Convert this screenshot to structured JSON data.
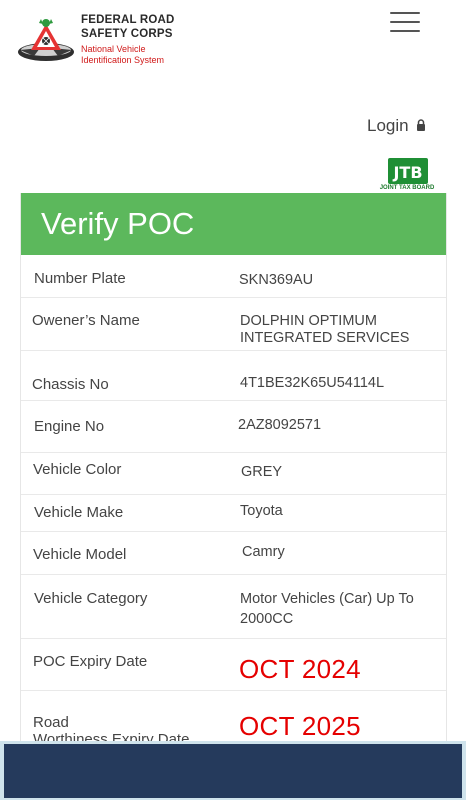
{
  "header": {
    "logo_line1": "FEDERAL ROAD",
    "logo_line2": "SAFETY CORPS",
    "logo_sub1": "National Vehicle",
    "logo_sub2": "Identification System",
    "menu_icon": "hamburger-menu-icon"
  },
  "login": {
    "label": "Login",
    "icon": "lock-icon"
  },
  "jtb": {
    "badge": "JTB",
    "caption": "JOINT TAX BOARD"
  },
  "card": {
    "title": "Verify POC",
    "rows": [
      {
        "label": "Number Plate",
        "value": "SKN369AU"
      },
      {
        "label": "Owener’s Name",
        "value_line1": "DOLPHIN OPTIMUM",
        "value_line2": "INTEGRATED SERVICES"
      },
      {
        "label": "Chassis No",
        "value": "4T1BE32K65U54114L"
      },
      {
        "label": "Engine No",
        "value": "2AZ8092571"
      },
      {
        "label": "Vehicle Color",
        "value": "GREY"
      },
      {
        "label": "Vehicle Make",
        "value": "Toyota"
      },
      {
        "label": "Vehicle Model",
        "value": "Camry"
      },
      {
        "label": "Vehicle Category",
        "value_line1": "Motor Vehicles (Car) Up To",
        "value_line2": "2000CC"
      },
      {
        "label": "POC Expiry Date",
        "value": "OCT 2024"
      },
      {
        "label_line1": "Road",
        "label_line2": "Worthiness Expiry Date",
        "value": "OCT 2025"
      }
    ]
  },
  "colors": {
    "header_green": "#5cb85c",
    "expiry_red": "#e50000",
    "logo_red": "#d01a1a",
    "bottom_bar": "#253a5c"
  }
}
